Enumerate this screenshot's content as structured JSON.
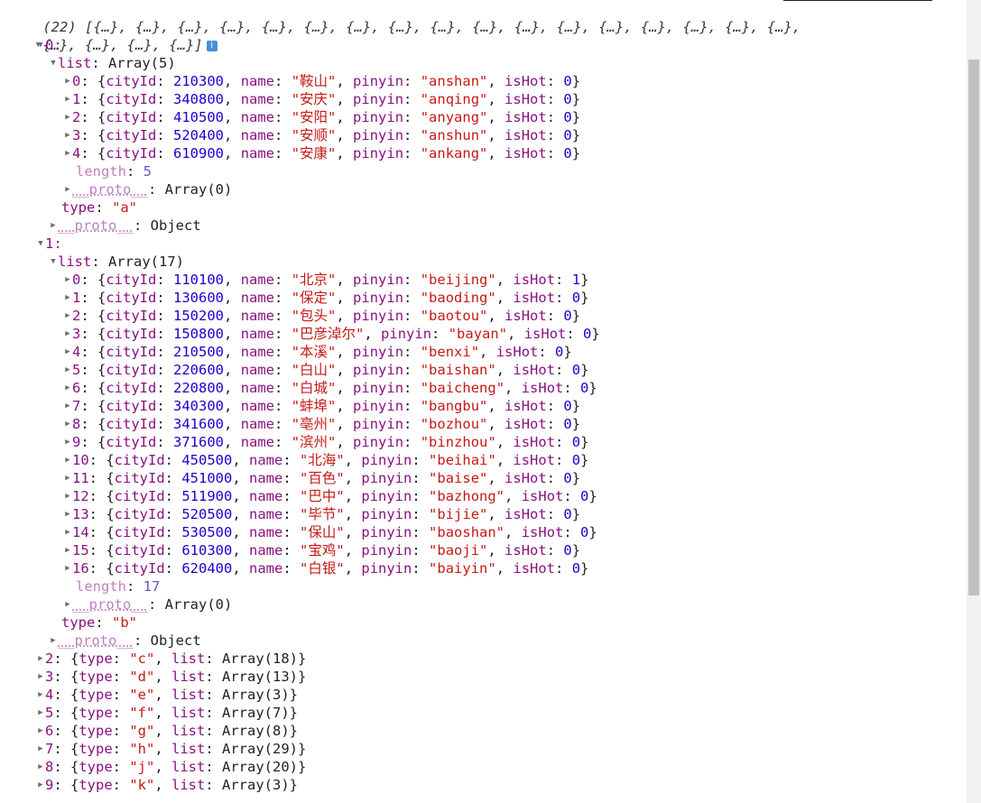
{
  "root": {
    "summary_line1": "(22) [{…}, {…}, {…}, {…}, {…}, {…}, {…}, {…}, {…}, {…}, {…}, {…}, {…}, {…}, {…}, {…}, {…},",
    "summary_line2": "{…}, {…}, {…}, {…}]",
    "info_badge": "i"
  },
  "groups": [
    {
      "index": "0",
      "list_label": "Array(5)",
      "items": [
        {
          "i": "0",
          "cityId": "210300",
          "name": "鞍山",
          "pinyin": "anshan",
          "isHot": "0"
        },
        {
          "i": "1",
          "cityId": "340800",
          "name": "安庆",
          "pinyin": "anqing",
          "isHot": "0"
        },
        {
          "i": "2",
          "cityId": "410500",
          "name": "安阳",
          "pinyin": "anyang",
          "isHot": "0"
        },
        {
          "i": "3",
          "cityId": "520400",
          "name": "安顺",
          "pinyin": "anshun",
          "isHot": "0"
        },
        {
          "i": "4",
          "cityId": "610900",
          "name": "安康",
          "pinyin": "ankang",
          "isHot": "0"
        }
      ],
      "length": "5",
      "type": "a"
    },
    {
      "index": "1",
      "list_label": "Array(17)",
      "items": [
        {
          "i": "0",
          "cityId": "110100",
          "name": "北京",
          "pinyin": "beijing",
          "isHot": "1"
        },
        {
          "i": "1",
          "cityId": "130600",
          "name": "保定",
          "pinyin": "baoding",
          "isHot": "0"
        },
        {
          "i": "2",
          "cityId": "150200",
          "name": "包头",
          "pinyin": "baotou",
          "isHot": "0"
        },
        {
          "i": "3",
          "cityId": "150800",
          "name": "巴彦淖尔",
          "pinyin": "bayan",
          "isHot": "0"
        },
        {
          "i": "4",
          "cityId": "210500",
          "name": "本溪",
          "pinyin": "benxi",
          "isHot": "0"
        },
        {
          "i": "5",
          "cityId": "220600",
          "name": "白山",
          "pinyin": "baishan",
          "isHot": "0"
        },
        {
          "i": "6",
          "cityId": "220800",
          "name": "白城",
          "pinyin": "baicheng",
          "isHot": "0"
        },
        {
          "i": "7",
          "cityId": "340300",
          "name": "蚌埠",
          "pinyin": "bangbu",
          "isHot": "0"
        },
        {
          "i": "8",
          "cityId": "341600",
          "name": "亳州",
          "pinyin": "bozhou",
          "isHot": "0"
        },
        {
          "i": "9",
          "cityId": "371600",
          "name": "滨州",
          "pinyin": "binzhou",
          "isHot": "0"
        },
        {
          "i": "10",
          "cityId": "450500",
          "name": "北海",
          "pinyin": "beihai",
          "isHot": "0"
        },
        {
          "i": "11",
          "cityId": "451000",
          "name": "百色",
          "pinyin": "baise",
          "isHot": "0"
        },
        {
          "i": "12",
          "cityId": "511900",
          "name": "巴中",
          "pinyin": "bazhong",
          "isHot": "0"
        },
        {
          "i": "13",
          "cityId": "520500",
          "name": "毕节",
          "pinyin": "bijie",
          "isHot": "0"
        },
        {
          "i": "14",
          "cityId": "530500",
          "name": "保山",
          "pinyin": "baoshan",
          "isHot": "0"
        },
        {
          "i": "15",
          "cityId": "610300",
          "name": "宝鸡",
          "pinyin": "baoji",
          "isHot": "0"
        },
        {
          "i": "16",
          "cityId": "620400",
          "name": "白银",
          "pinyin": "baiyin",
          "isHot": "0"
        }
      ],
      "length": "17",
      "type": "b"
    }
  ],
  "collapsed": [
    {
      "index": "2",
      "type": "c",
      "list": "Array(18)"
    },
    {
      "index": "3",
      "type": "d",
      "list": "Array(13)"
    },
    {
      "index": "4",
      "type": "e",
      "list": "Array(3)"
    },
    {
      "index": "5",
      "type": "f",
      "list": "Array(7)"
    },
    {
      "index": "6",
      "type": "g",
      "list": "Array(8)"
    },
    {
      "index": "7",
      "type": "h",
      "list": "Array(29)"
    },
    {
      "index": "8",
      "type": "j",
      "list": "Array(20)"
    },
    {
      "index": "9",
      "type": "k",
      "list": "Array(3)"
    }
  ],
  "labels": {
    "list_key": "list",
    "length_key": "length",
    "type_key": "type",
    "proto_key": "__proto__",
    "proto_array": "Array(0)",
    "proto_object": "Object",
    "cityId_key": "cityId",
    "name_key": "name",
    "pinyin_key": "pinyin",
    "isHot_key": "isHot"
  },
  "colors": {
    "key": "#881280",
    "number": "#1c00cf",
    "string": "#c41a16",
    "dim_key": "#c080c0"
  },
  "icons": {
    "expanded": "triangle-down-icon",
    "collapsed": "triangle-right-icon",
    "info": "info-icon"
  }
}
